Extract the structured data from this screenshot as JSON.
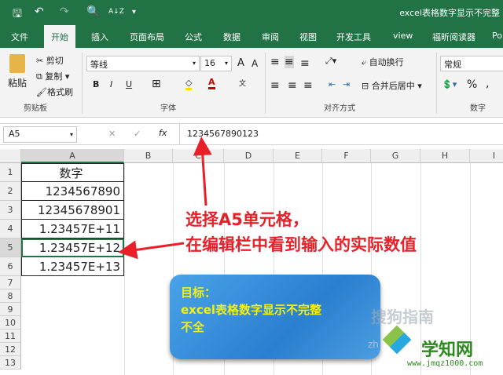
{
  "window": {
    "title": "excel表格数字显示不完整"
  },
  "quick_access": {
    "save": "🖫",
    "undo": "↶",
    "redo": "↷",
    "preview": "🔍",
    "sort": "A↓Z",
    "more": "▾"
  },
  "tabs": [
    {
      "label": "文件"
    },
    {
      "label": "开始"
    },
    {
      "label": "插入"
    },
    {
      "label": "页面布局"
    },
    {
      "label": "公式"
    },
    {
      "label": "数据"
    },
    {
      "label": "审阅"
    },
    {
      "label": "视图"
    },
    {
      "label": "开发工具"
    },
    {
      "label": "view"
    },
    {
      "label": "福昕阅读器"
    },
    {
      "label": "Po"
    }
  ],
  "ribbon": {
    "clipboard": {
      "paste": "粘贴",
      "cut": "剪切",
      "copy": "复制",
      "format_painter": "格式刷",
      "group": "剪贴板"
    },
    "font": {
      "name": "等线",
      "size": "16",
      "bold": "B",
      "italic": "I",
      "underline": "U",
      "grow": "A",
      "shrink": "A",
      "group": "字体"
    },
    "alignment": {
      "wrap": "自动换行",
      "merge": "合并后居中",
      "group": "对齐方式"
    },
    "number": {
      "format": "常规",
      "percent": "%",
      "comma": ",",
      "group": "数字"
    }
  },
  "formula_bar": {
    "name_box": "A5",
    "cancel": "✕",
    "enter": "✓",
    "fx": "fx",
    "value": "1234567890123"
  },
  "sheet": {
    "columns": [
      "A",
      "B",
      "C",
      "D",
      "E",
      "F",
      "G",
      "H",
      "I"
    ],
    "rows": [
      "1",
      "2",
      "3",
      "4",
      "5",
      "6",
      "7",
      "8",
      "9",
      "10",
      "11",
      "12",
      "13"
    ],
    "cells": [
      "数字",
      "1234567890",
      "12345678901",
      "1.23457E+11",
      "1.23457E+12",
      "1.23457E+13"
    ]
  },
  "annotation": {
    "line1": "选择A5单元格，",
    "line2": "在编辑栏中看到输入的实际数值"
  },
  "goal_box": {
    "line1": "目标：",
    "line2": "excel表格数字显示不完整",
    "line3": "不全"
  },
  "watermarks": {
    "sogou": "搜狗指南",
    "site_name": "学知网",
    "site_url": "www.jmqz1000.com",
    "zh": "zh"
  },
  "colors": {
    "excel_green": "#217346",
    "annotation_red": "#e8202a"
  }
}
